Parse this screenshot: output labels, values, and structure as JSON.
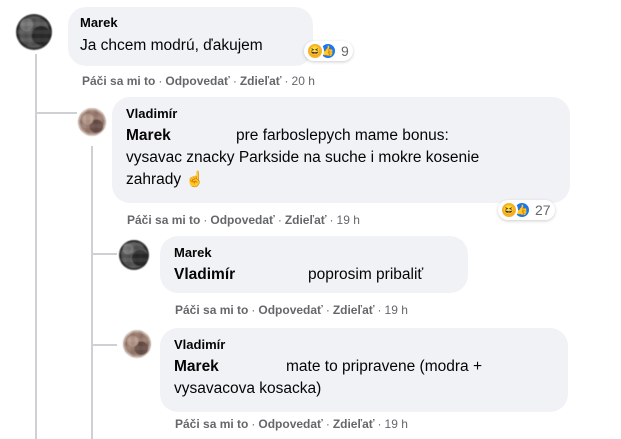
{
  "colors": {
    "bubble_bg": "#f0f2f5",
    "meta_text": "#65676b",
    "thread_line": "#ced0d4",
    "like_blue": "#1877f2",
    "haha_yellow": "#f7b125"
  },
  "icons": {
    "reaction_haha": "haha-emoji",
    "reaction_like": "thumbs-up",
    "text_emoji": "pointing-up-hand"
  },
  "comments": [
    {
      "author": "Marek",
      "text": "Ja chcem modrú, ďakujem",
      "reactions_count": "9",
      "actions": {
        "like": "Páči sa mi to",
        "reply": "Odpovedať",
        "share": "Zdieľať",
        "time": "20 h"
      }
    },
    {
      "author": "Vladimír",
      "mention": "Marek",
      "text_line1": "pre farboslepych mame bonus:",
      "text_line2": "vysavac znacky Parkside na suche i mokre kosenie",
      "text_line3": "zahrady",
      "emoji": "☝",
      "reactions_count": "27",
      "actions": {
        "like": "Páči sa mi to",
        "reply": "Odpovedať",
        "share": "Zdieľať",
        "time": "19 h"
      }
    },
    {
      "author": "Marek",
      "mention": "Vladimír",
      "text": "poprosim pribaliť",
      "actions": {
        "like": "Páči sa mi to",
        "reply": "Odpovedať",
        "share": "Zdieľať",
        "time": "19 h"
      }
    },
    {
      "author": "Vladimír",
      "mention": "Marek",
      "text_line1": "mate to pripravene (modra +",
      "text_line2": "vysavacova kosacka)",
      "actions": {
        "like": "Páči sa mi to",
        "reply": "Odpovedať",
        "share": "Zdieľať",
        "time": "19 h"
      }
    }
  ]
}
